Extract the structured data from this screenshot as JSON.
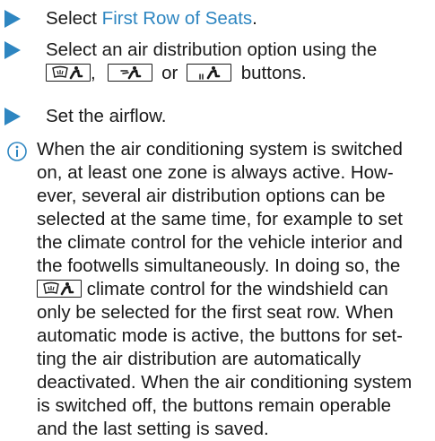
{
  "steps": [
    {
      "pre": "Select ",
      "link": "First Row of Seats",
      "post": "."
    },
    {
      "line1": "Select an air distribution option using the",
      "sep1": ",",
      "sep2": "or",
      "post": "buttons."
    },
    {
      "text": "Set the airflow."
    }
  ],
  "note": {
    "lines": [
      "When the air conditioning system is switched",
      "on, at least one zone is always active. How-",
      "ever, several air distribution options can be",
      "selected at the same time, for example to set",
      "the climate control for the vehicle interior and",
      "the footwells simultaneously. In doing so, the",
      " climate control for the windshield can",
      "only be selected for the first seat row. When",
      "automatic mode is active, the buttons for set-",
      "ting the air distribution are automatically",
      "deactivated. When the air conditioning system",
      "is switched off, the buttons remain operable",
      "and the last setting is saved."
    ]
  },
  "icons": {
    "step_arrow": "triangle-right-icon",
    "info": "info-circle-icon",
    "btn_windshield": "airflow-windshield-icon",
    "btn_center": "airflow-center-icon",
    "btn_footwell": "airflow-footwell-icon"
  },
  "colors": {
    "arrow": "#2e86c1",
    "link": "#2e86c1",
    "info": "#2e86c1"
  }
}
